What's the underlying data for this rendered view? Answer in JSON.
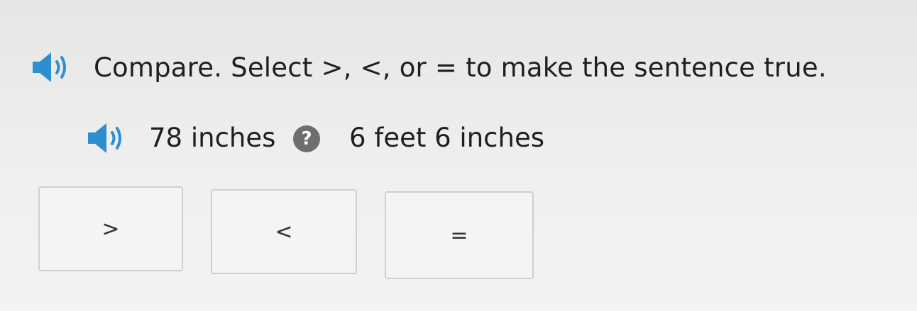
{
  "question": {
    "prompt": "Compare. Select >, <, or = to make the sentence true.",
    "prompt_audio_icon": "speaker-icon"
  },
  "sentence": {
    "audio_icon": "speaker-icon",
    "left_quantity": "78 inches",
    "unknown_symbol": "?",
    "right_quantity": "6 feet 6 inches"
  },
  "choices": [
    {
      "id": "gt",
      "label": ">"
    },
    {
      "id": "lt",
      "label": "<"
    },
    {
      "id": "eq",
      "label": "="
    }
  ],
  "colors": {
    "speaker": "#2e8fd0",
    "badge": "#6e6e6e",
    "choice_border": "#cfcfcf"
  }
}
